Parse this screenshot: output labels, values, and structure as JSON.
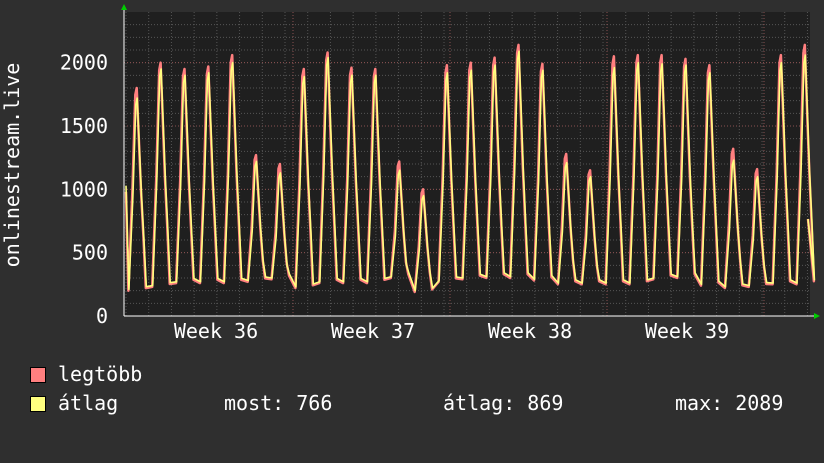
{
  "chart_data": {
    "type": "line",
    "ylabel": "onlinestream.live",
    "ylim": [
      0,
      2400
    ],
    "y_ticks": [
      0,
      500,
      1000,
      1500,
      2000
    ],
    "y_tick_labels": [
      "0",
      "500",
      "1000",
      "1500",
      "2000"
    ],
    "x_tick_labels": [
      "Week 36",
      "Week 37",
      "Week 38",
      "Week 39"
    ],
    "grid": true,
    "legend_position": "bottom-left",
    "series": [
      {
        "name": "legtöbb",
        "color": "#ff7f7f",
        "peaks": [
          1800,
          2000,
          1950,
          1970,
          2060,
          1270,
          1200,
          1950,
          2080,
          1960,
          1950,
          1220,
          1000,
          1980,
          2000,
          2040,
          2140,
          1990,
          1280,
          1150,
          2050,
          2060,
          2060,
          2030,
          1980,
          1320,
          1160,
          2060,
          2140
        ],
        "troughs": [
          200,
          230,
          260,
          260,
          260,
          270,
          290,
          220,
          260,
          260,
          260,
          300,
          190,
          270,
          290,
          300,
          300,
          280,
          250,
          250,
          250,
          250,
          290,
          300,
          240,
          220,
          230,
          250
        ]
      },
      {
        "name": "átlag",
        "color": "#ffff7f",
        "peaks": [
          1720,
          1950,
          1900,
          1920,
          2000,
          1220,
          1130,
          1890,
          2040,
          1900,
          1900,
          1150,
          950,
          1920,
          1940,
          1980,
          2090,
          1940,
          1210,
          1100,
          1960,
          2000,
          1990,
          1980,
          1920,
          1230,
          1100,
          2000,
          2060
        ],
        "troughs": [
          210,
          240,
          270,
          270,
          270,
          280,
          300,
          230,
          270,
          270,
          270,
          310,
          200,
          280,
          300,
          310,
          310,
          290,
          260,
          260,
          260,
          260,
          300,
          310,
          250,
          230,
          240,
          260
        ]
      }
    ],
    "stats": {
      "now": 766,
      "average": 869,
      "max": 2089
    }
  },
  "legend": {
    "max_label": "legtöbb",
    "avg_label": "átlag",
    "now_label": "most: 766",
    "average_label": "átlag: 869",
    "max_value_label": "max: 2089"
  },
  "colors": {
    "background": "#2f2f2f",
    "plot_background": "#1f1f1f",
    "grid": "#555555",
    "text": "#ffffff",
    "axis": "#ffffff",
    "arrow": "#00cc00"
  }
}
